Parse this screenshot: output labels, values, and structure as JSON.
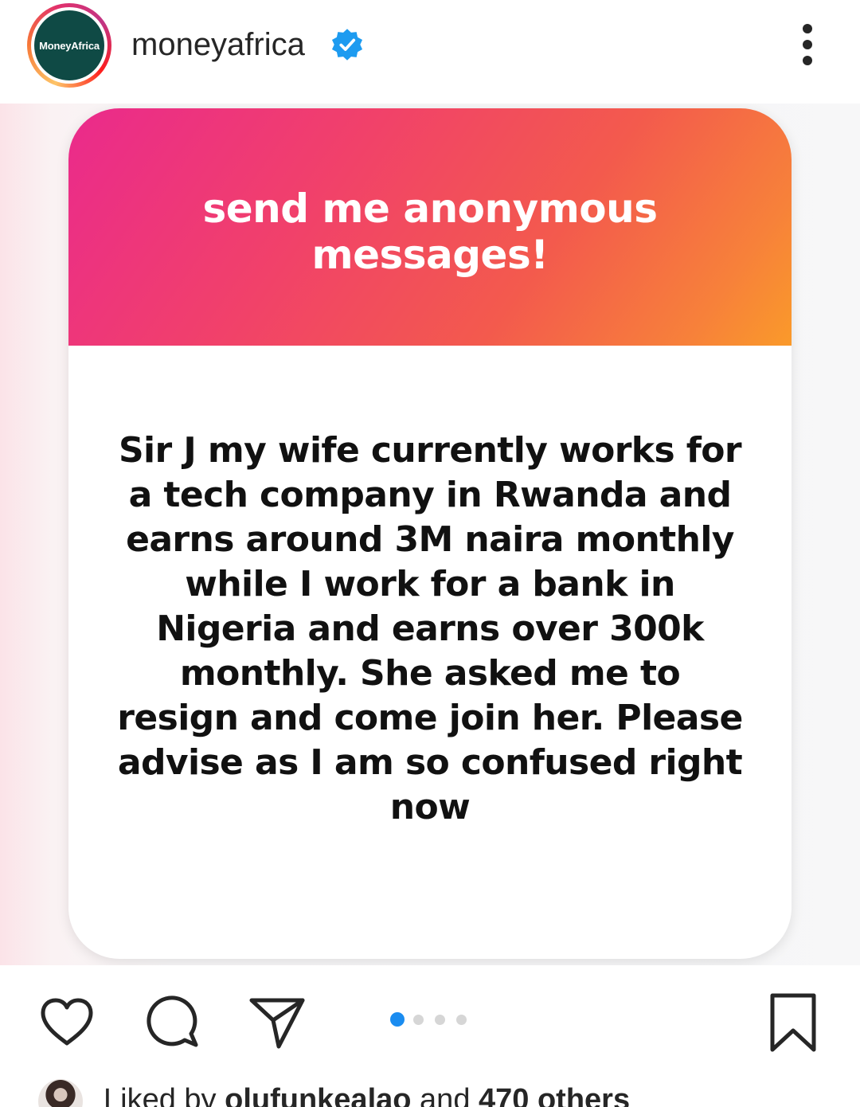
{
  "header": {
    "avatar_text": "MoneyAfrica",
    "username": "moneyafrica",
    "verified_icon": "verified-badge-icon",
    "more_icon": "more-vertical-icon"
  },
  "post": {
    "prompt": "send me anonymous messages!",
    "message": "Sir J my wife currently works for a tech company in Rwanda and earns around 3M naira monthly while I work for a bank in Nigeria and earns over 300k monthly. She asked me to resign and come join her. Please advise as I am so confused right now",
    "carousel": {
      "count": 4,
      "active_index": 0
    }
  },
  "actions": {
    "like_icon": "heart-icon",
    "comment_icon": "comment-icon",
    "share_icon": "send-icon",
    "save_icon": "bookmark-icon"
  },
  "likes": {
    "prefix": "Liked by",
    "user": "olufunkealao",
    "connector": "and",
    "others": "470 others"
  },
  "colors": {
    "accent_blue": "#1a8cf0",
    "gradient_start": "#ea2a8c",
    "gradient_end": "#fa9a2a",
    "avatar_bg": "#0f4a45"
  }
}
